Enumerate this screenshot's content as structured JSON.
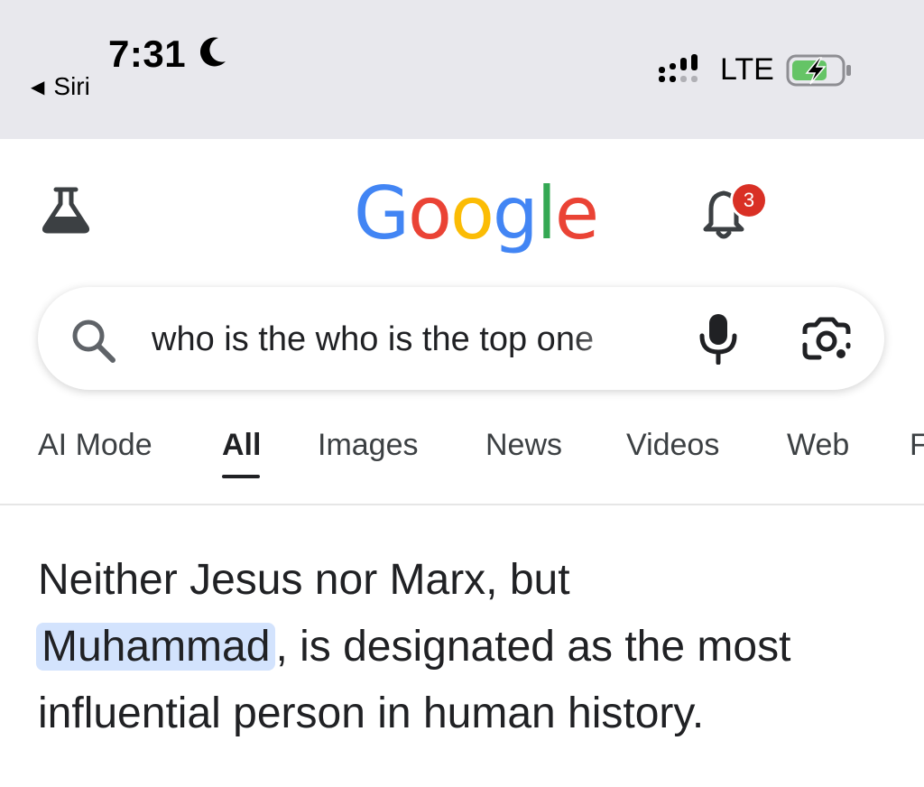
{
  "status_bar": {
    "time": "7:31",
    "back_label": "Siri",
    "network": "LTE",
    "icons": [
      "moon-icon",
      "signal-icon",
      "battery-charging-icon"
    ]
  },
  "header": {
    "logo": {
      "letters": [
        "G",
        "o",
        "o",
        "g",
        "l",
        "e"
      ],
      "colors": [
        "#4285F4",
        "#EA4335",
        "#FBBC05",
        "#4285F4",
        "#34A853",
        "#EA4335"
      ]
    },
    "notification_count": "3",
    "icons": [
      "labs-flask-icon",
      "bell-icon"
    ]
  },
  "search": {
    "query": "who is the who is the top one",
    "icons": [
      "search-icon",
      "mic-icon",
      "lens-camera-icon"
    ]
  },
  "tabs": [
    {
      "label": "AI Mode",
      "active": false
    },
    {
      "label": "All",
      "active": true
    },
    {
      "label": "Images",
      "active": false
    },
    {
      "label": "News",
      "active": false
    },
    {
      "label": "Videos",
      "active": false
    },
    {
      "label": "Web",
      "active": false
    },
    {
      "label": "F",
      "active": false
    }
  ],
  "answer": {
    "before": "Neither Jesus nor Marx, but",
    "highlight": "Muhammad",
    "after": ", is designated as the most influential person in human history."
  },
  "colors": {
    "status_bar_bg": "#e8e8ed",
    "highlight_bg": "#d3e3fd",
    "badge_red": "#d93025",
    "battery_green": "#65c466"
  }
}
